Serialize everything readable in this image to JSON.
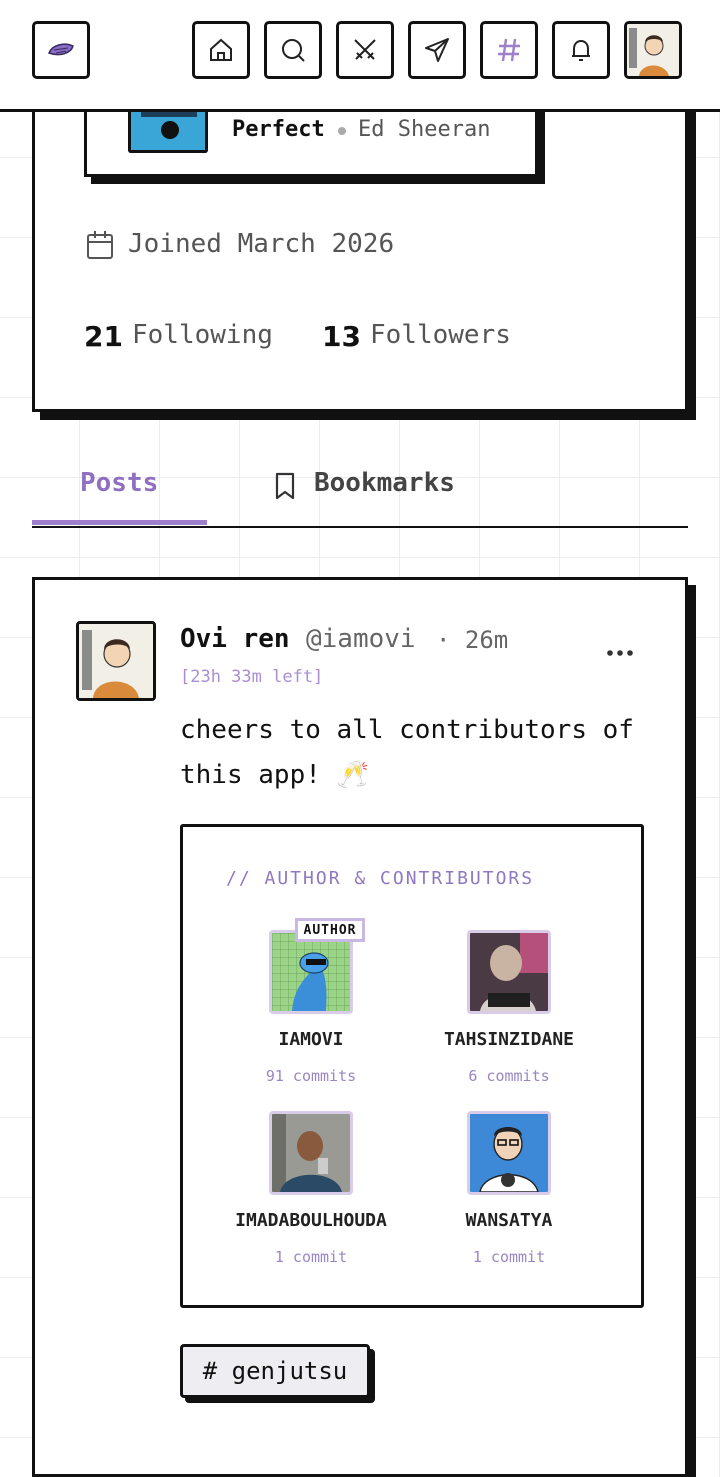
{
  "header": {
    "nav_items": [
      "home",
      "search",
      "battle",
      "send",
      "hashtag",
      "notifications",
      "profile"
    ]
  },
  "profile": {
    "now_playing": {
      "title": "Perfect",
      "artist": "Ed Sheeran"
    },
    "joined": "Joined March 2026",
    "following_count": "21",
    "following_label": "Following",
    "followers_count": "13",
    "followers_label": "Followers"
  },
  "tabs": {
    "posts": "Posts",
    "bookmarks": "Bookmarks",
    "active": "Posts"
  },
  "post": {
    "author_name": "Ovi ren",
    "handle": "@iamovi",
    "time": "· 26m",
    "time_left": "[23h 33m left]",
    "text": "cheers to all contributors of this app! 🥂",
    "contributors_heading": "// AUTHOR & CONTRIBUTORS",
    "author_badge": "AUTHOR",
    "contributors": [
      {
        "name": "IAMOVI",
        "commits": "91 commits"
      },
      {
        "name": "TAHSINZIDANE",
        "commits": "6 commits"
      },
      {
        "name": "IMADABOULHOUDA",
        "commits": "1 commit"
      },
      {
        "name": "WANSATYA",
        "commits": "1 commit"
      }
    ],
    "tag": "# genjutsu"
  },
  "colors": {
    "accent": "#9d7fcc",
    "ink": "#111111",
    "muted": "#555555"
  }
}
